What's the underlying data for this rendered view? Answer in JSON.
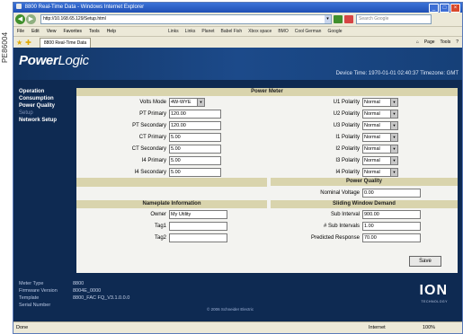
{
  "image_code": "PE86004",
  "browser": {
    "title": "8800 Real-Time Data - Windows Internet Explorer",
    "address": "http://10.168.65.129/Setup.html",
    "search_placeholder": "Search Google",
    "menu": [
      "File",
      "Edit",
      "View",
      "Favorites",
      "Tools",
      "Help"
    ],
    "links": [
      "Links",
      "Links",
      "Planet",
      "Babel Fish",
      "Xbox space",
      "BMO",
      "Cool German",
      "Google"
    ],
    "tab_label": "8800 Real-Time Data",
    "tab_tools": [
      "Page",
      "Tools"
    ],
    "status_text": "Done",
    "zone": "Internet",
    "zoom": "100%"
  },
  "app": {
    "logo_power": "Power",
    "logo_logic": "Logic",
    "device_time": "Device Time: 1970-01-01 02:40:37 Timezone: GMT"
  },
  "sidebar": {
    "items": [
      {
        "label": "Operation"
      },
      {
        "label": "Consumption"
      },
      {
        "label": "Power Quality"
      },
      {
        "label": "Setup"
      },
      {
        "label": "Network Setup"
      }
    ]
  },
  "power_meter": {
    "title": "Power Meter",
    "left_fields": [
      {
        "label": "Volts Mode",
        "value": "4W-WYE"
      },
      {
        "label": "PT Primary",
        "value": "120.00"
      },
      {
        "label": "PT Secondary",
        "value": "120.00"
      },
      {
        "label": "CT Primary",
        "value": "5.00"
      },
      {
        "label": "CT Secondary",
        "value": "5.00"
      },
      {
        "label": "I4 Primary",
        "value": "5.00"
      },
      {
        "label": "I4 Secondary",
        "value": "5.00"
      }
    ],
    "right_fields": [
      {
        "label": "U1 Polarity",
        "value": "Normal"
      },
      {
        "label": "U2 Polarity",
        "value": "Normal"
      },
      {
        "label": "U3 Polarity",
        "value": "Normal"
      },
      {
        "label": "I1 Polarity",
        "value": "Normal"
      },
      {
        "label": "I2 Polarity",
        "value": "Normal"
      },
      {
        "label": "I3 Polarity",
        "value": "Normal"
      },
      {
        "label": "I4 Polarity",
        "value": "Normal"
      }
    ]
  },
  "power_quality": {
    "title": "Power Quality",
    "nominal_voltage_label": "Nominal Voltage",
    "nominal_voltage_value": "0.00"
  },
  "nameplate": {
    "title": "Nameplate Information",
    "fields": [
      {
        "label": "Owner",
        "value": "My Utility"
      },
      {
        "label": "Tag1",
        "value": ""
      },
      {
        "label": "Tag2",
        "value": ""
      }
    ]
  },
  "sliding_window": {
    "title": "Sliding Window Demand",
    "fields": [
      {
        "label": "Sub Interval",
        "value": "900.00"
      },
      {
        "label": "# Sub Intervals",
        "value": "1.00"
      },
      {
        "label": "Predicted Response",
        "value": "70.00"
      }
    ]
  },
  "save_label": "Save",
  "footer": {
    "rows": [
      {
        "label": "Meter Type",
        "value": "8800"
      },
      {
        "label": "Firmware Version",
        "value": "8004E_0000"
      },
      {
        "label": "Template",
        "value": "8800_FAC FQ_V3.1.0.0.0"
      },
      {
        "label": "Serial Number",
        "value": ""
      }
    ],
    "copyright": "© 2006 Schneider Electric",
    "ion_logo": "ION",
    "ion_sub": "TECHNOLOGY"
  }
}
